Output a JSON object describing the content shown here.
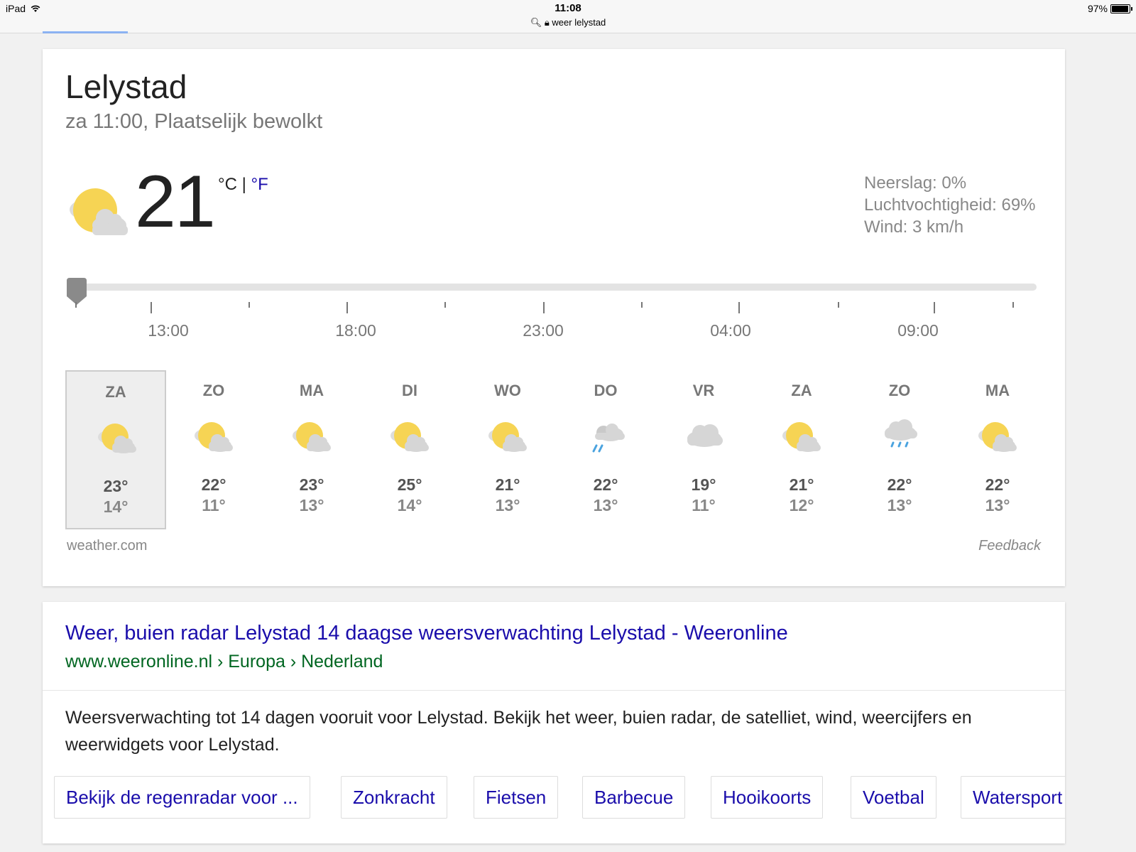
{
  "status_bar": {
    "device": "iPad",
    "time": "11:08",
    "url": "weer lelystad",
    "battery": "97%",
    "battery_level": 0.97
  },
  "weather": {
    "city": "Lelystad",
    "condition": "za 11:00, Plaatselijk bewolkt",
    "current_icon": "partly-cloudy-icon",
    "temperature": "21",
    "unit_c": "°C",
    "unit_sep": "|",
    "unit_f": "°F",
    "details": {
      "precipitation": "Neerslag: 0%",
      "humidity": "Luchtvochtigheid: 69%",
      "wind": "Wind: 3 km/h"
    },
    "timeline": {
      "labels": [
        "13:00",
        "18:00",
        "23:00",
        "04:00",
        "09:00"
      ],
      "slider_position": 0
    },
    "days": [
      {
        "name": "ZA",
        "hi": "23°",
        "lo": "14°",
        "icon": "partly-cloudy-icon",
        "selected": true
      },
      {
        "name": "ZO",
        "hi": "22°",
        "lo": "11°",
        "icon": "partly-cloudy-icon"
      },
      {
        "name": "MA",
        "hi": "23°",
        "lo": "13°",
        "icon": "partly-cloudy-icon"
      },
      {
        "name": "DI",
        "hi": "25°",
        "lo": "14°",
        "icon": "partly-cloudy-icon"
      },
      {
        "name": "WO",
        "hi": "21°",
        "lo": "13°",
        "icon": "partly-cloudy-icon"
      },
      {
        "name": "DO",
        "hi": "22°",
        "lo": "13°",
        "icon": "rain-showers-icon"
      },
      {
        "name": "VR",
        "hi": "19°",
        "lo": "11°",
        "icon": "cloudy-icon"
      },
      {
        "name": "ZA",
        "hi": "21°",
        "lo": "12°",
        "icon": "partly-cloudy-icon"
      },
      {
        "name": "ZO",
        "hi": "22°",
        "lo": "13°",
        "icon": "rain-icon"
      },
      {
        "name": "MA",
        "hi": "22°",
        "lo": "13°",
        "icon": "partly-cloudy-icon"
      }
    ],
    "source": "weather.com",
    "feedback": "Feedback"
  },
  "result": {
    "title": "Weer, buien radar Lelystad 14 daagse weersverwachting Lelystad - Weeronline",
    "url": "www.weeronline.nl › Europa › Nederland",
    "description": "Weersverwachting tot 14 dagen vooruit voor Lelystad. Bekijk het weer, buien radar, de satelliet, wind, weercijfers en weerwidgets voor Lelystad.",
    "chips": [
      "Bekijk de regenradar voor ...",
      "Zonkracht",
      "Fietsen",
      "Barbecue",
      "Hooikoorts",
      "Voetbal",
      "Watersport"
    ]
  }
}
